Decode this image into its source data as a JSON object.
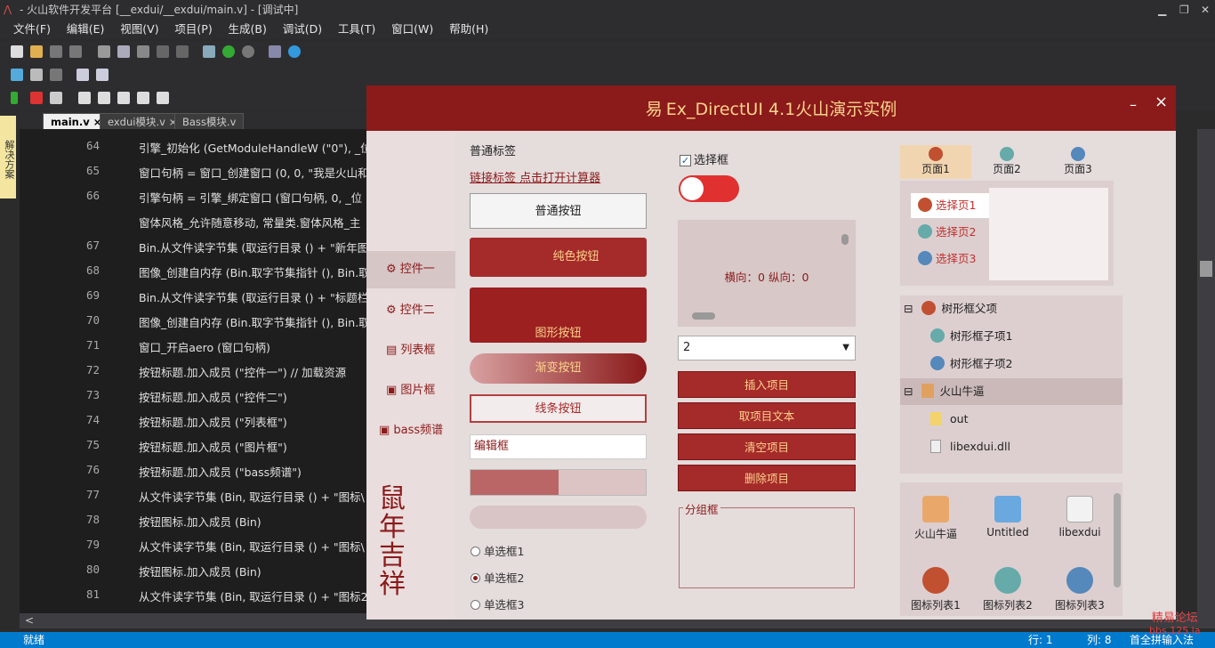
{
  "window": {
    "title": "- 火山软件开发平台 [__exdui/__exdui/main.v] - [调试中]"
  },
  "menu": [
    "文件(F)",
    "编辑(E)",
    "视图(V)",
    "项目(P)",
    "生成(B)",
    "调试(D)",
    "工具(T)",
    "窗口(W)",
    "帮助(H)"
  ],
  "side_panel": "解决方案",
  "tabs": [
    {
      "label": "main.v",
      "close": "×"
    },
    {
      "label": "exdui模块.v",
      "close": "×"
    },
    {
      "label": "Bass模块.v",
      "close": ""
    }
  ],
  "code_lines": [
    {
      "num": "64",
      "text": "引擎_初始化 (GetModuleHandleW (\"0\"), _位"
    },
    {
      "num": "65",
      "text": "窗口句柄 = 窗口_创建窗口 (0, 0, \"我是火山和"
    },
    {
      "num": "66",
      "text": "引擎句柄 = 引擎_绑定窗口 (窗口句柄, 0, _位"
    },
    {
      "num": "",
      "text": "窗体风格_允许随意移动, 常量类.窗体风格_主"
    },
    {
      "num": "67",
      "text": "Bin.从文件读字节集 (取运行目录 () + \"新年图"
    },
    {
      "num": "68",
      "text": "图像_创建自内存 (Bin.取字节集指针 (), Bin.取"
    },
    {
      "num": "69",
      "text": "Bin.从文件读字节集 (取运行目录 () + \"标题栏"
    },
    {
      "num": "70",
      "text": "图像_创建自内存 (Bin.取字节集指针 (), Bin.取"
    },
    {
      "num": "71",
      "text": "窗口_开启aero (窗口句柄)"
    },
    {
      "num": "72",
      "text": "按钮标题.加入成员 (\"控件一\") // 加载资源"
    },
    {
      "num": "73",
      "text": "按钮标题.加入成员 (\"控件二\")"
    },
    {
      "num": "74",
      "text": "按钮标题.加入成员 (\"列表框\")"
    },
    {
      "num": "75",
      "text": "按钮标题.加入成员 (\"图片框\")"
    },
    {
      "num": "76",
      "text": "按钮标题.加入成员 (\"bass频谱\")"
    },
    {
      "num": "77",
      "text": "从文件读字节集 (Bin, 取运行目录 () + \"图标\\"
    },
    {
      "num": "78",
      "text": "按钮图标.加入成员 (Bin)"
    },
    {
      "num": "79",
      "text": "从文件读字节集 (Bin, 取运行目录 () + \"图标\\"
    },
    {
      "num": "80",
      "text": "按钮图标.加入成员 (Bin)"
    },
    {
      "num": "81",
      "text": "从文件读字节集 (Bin, 取运行目录 () + \"图标2"
    },
    {
      "num": "82",
      "text": "按钮图标.加入成员 (Bin)"
    }
  ],
  "status": {
    "text": "就绪",
    "row": "行: 1",
    "col": "列: 8",
    "ime": "首全拼输入法"
  },
  "demo": {
    "title": "Ex_DirectUI 4.1火山演示实例",
    "logo_glyph": "易",
    "min": "–",
    "close": "×",
    "nav": [
      "控件一",
      "控件二",
      "列表框",
      "图片框",
      "bass频谱"
    ],
    "new_year": "鼠年吉祥",
    "plain_label": "普通标签",
    "link_label": "链接标签 点击打开计算器",
    "btn_plain": "普通按钮",
    "btn_solid": "纯色按钮",
    "btn_image": "图形按钮",
    "btn_gradient": "渐变按钮",
    "btn_line": "线条按钮",
    "edit_text": "编辑框",
    "progress": 0.5,
    "radios": [
      "单选框1",
      "单选框2",
      "单选框3"
    ],
    "radio_selected": 1,
    "checkbox_label": "选择框",
    "checkbox_checked": true,
    "scroll_text": "横向：0 纵向：0",
    "combo_value": "2",
    "list_buttons": [
      "插入项目",
      "取项目文本",
      "清空项目",
      "删除项目"
    ],
    "group_label": "分组框",
    "pages": [
      "页面1",
      "页面2",
      "页面3"
    ],
    "page_items": [
      "选择页1",
      "选择页2",
      "选择页3"
    ],
    "tree": [
      {
        "label": "树形框父项",
        "toggle": "⊟"
      },
      {
        "label": "树形框子项1",
        "toggle": ""
      },
      {
        "label": "树形框子项2",
        "toggle": ""
      },
      {
        "label": "火山牛逼",
        "toggle": "⊟"
      },
      {
        "label": "out",
        "toggle": ""
      },
      {
        "label": "libexdui.dll",
        "toggle": ""
      }
    ],
    "icons": [
      "火山牛逼",
      "Untitled",
      "libexdui",
      "图标列表1",
      "图标列表2",
      "图标列表3"
    ]
  },
  "watermark": [
    "精易论坛",
    "bbs.125.la"
  ],
  "colors": {
    "accent": "#8b1a1a",
    "gold": "#fbd28b",
    "status": "#007acc"
  }
}
